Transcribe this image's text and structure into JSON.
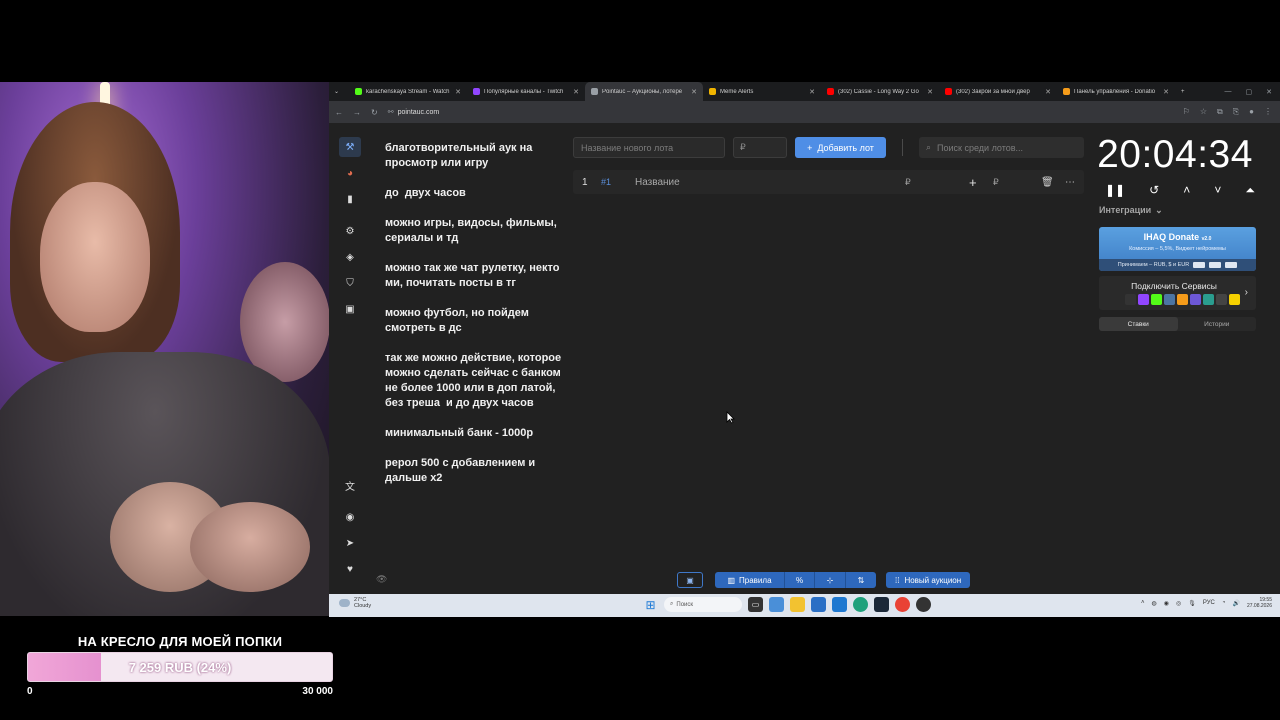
{
  "goal": {
    "title": "НА КРЕСЛО ДЛЯ МОЕЙ ПОПКИ",
    "progress_text": "7 259 RUB (24%)",
    "progress_fraction": 0.24,
    "min": "0",
    "max": "30 000"
  },
  "tabs": [
    {
      "title": "karachenskaya Stream - Watch",
      "color": "#53fc18",
      "active": false
    },
    {
      "title": "Популярные каналы - Twitch",
      "color": "#9146ff",
      "active": false
    },
    {
      "title": "Pointauc – Аукционы, лотере",
      "color": "#9aa0a6",
      "active": true
    },
    {
      "title": "Meme Alerts",
      "color": "#f0b400",
      "active": false
    },
    {
      "title": "(302) Cassie - Long Way 2 Go",
      "color": "#ff0000",
      "active": false
    },
    {
      "title": "(302) Закрой за мной двер",
      "color": "#ff0000",
      "active": false
    },
    {
      "title": "Панель управления - Donatio",
      "color": "#f59c1a",
      "active": false
    }
  ],
  "address": {
    "url": "pointauc.com"
  },
  "rules_text": "благотворительный аук на просмотр или игру\n\nдо  двух часов\n\nможно игры, видосы, фильмы, сериалы и тд\n\nможно так же чат рулетку, некто ми, почитать посты в тг\n\nможно футбол, но пойдем смотреть в дс\n\nтак же можно действие, которое можно сделать сейчас с банком не более 1000 или в доп латой, без треша  и до двух часов\n\nминимальный банк - 1000р\n\nрерол 500 с добавлением и дальше х2",
  "controls": {
    "lot_placeholder": "Название нового лота",
    "currency": "₽",
    "add_lot": "Добавить лот",
    "search_placeholder": "Поиск среди лотов..."
  },
  "lot": {
    "num": "1",
    "id": "#1",
    "name_placeholder": "Название",
    "currency": "₽"
  },
  "timer": "20:04:34",
  "integrations": {
    "label": "Интеграции",
    "donate_title": "IHAQ Donate",
    "donate_ver": "v2.0",
    "donate_sub": "Комиссия – 5,5%, Виджет нейромемы",
    "donate_bottom": "Принимаем – RUB, $ и EUR",
    "connect_title": "Подключить Сервисы",
    "tab_bids": "Ставки",
    "tab_history": "Истории"
  },
  "bottom": {
    "rules": "Правила",
    "percent": "%",
    "new_auction": "Новый аукцион"
  },
  "taskbar": {
    "temp": "27°C",
    "weather": "Cloudy",
    "search": "Поиск",
    "lang": "РУС",
    "time": "19:55",
    "date": "27.08.2026"
  },
  "colors": {
    "accent": "#4f8ee6",
    "goal_fill": "#e591cf"
  }
}
